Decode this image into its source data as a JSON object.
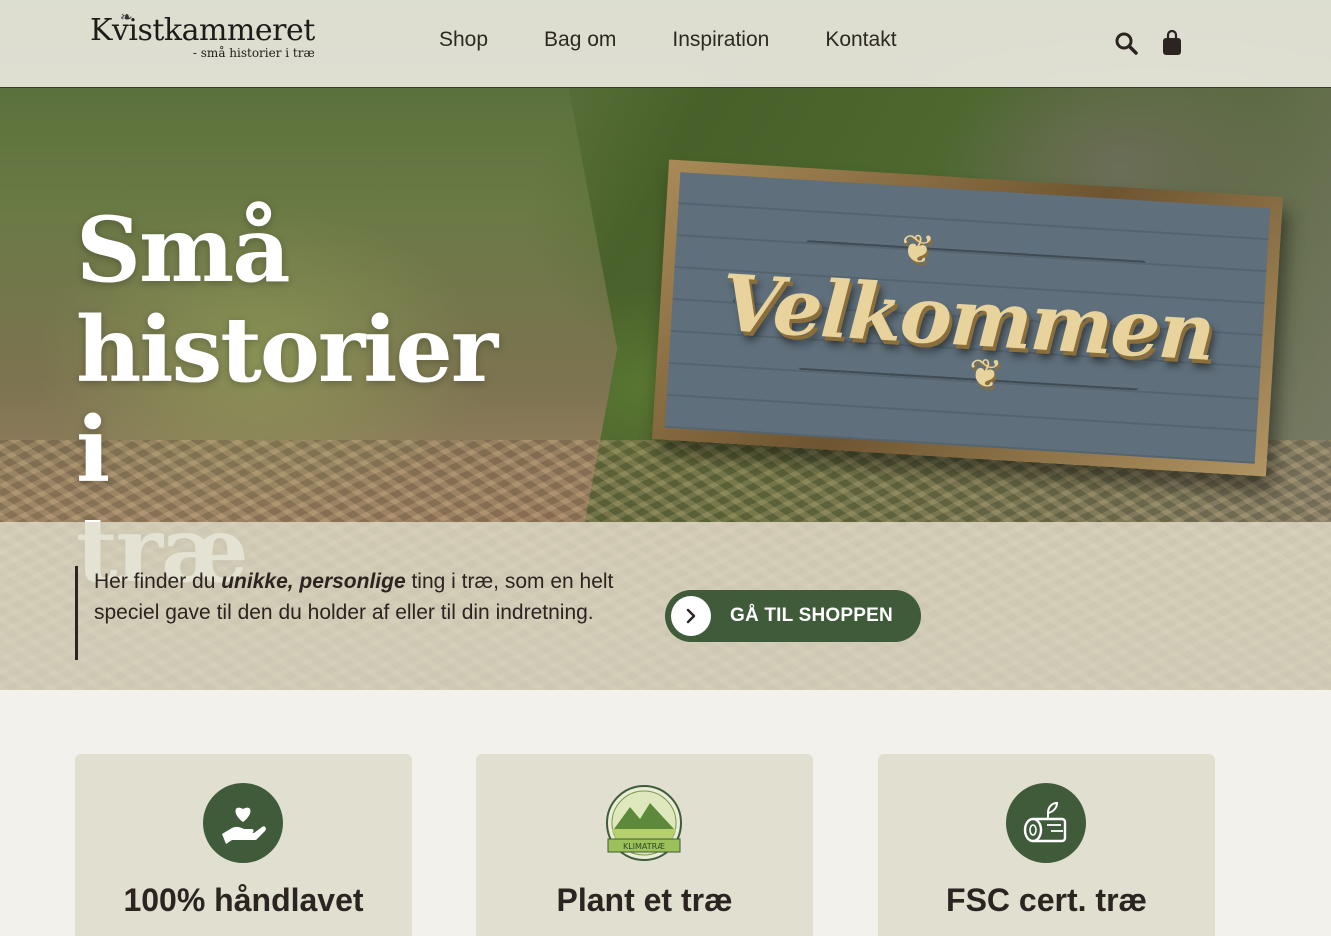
{
  "brand": {
    "name": "Kvistkammeret",
    "tagline": "- små historier i træ"
  },
  "nav": {
    "items": [
      {
        "label": "Shop"
      },
      {
        "label": "Bag om"
      },
      {
        "label": "Inspiration"
      },
      {
        "label": "Kontakt"
      }
    ]
  },
  "header_icons": [
    "search-icon",
    "shopping-bag-icon"
  ],
  "hero": {
    "title_lines": [
      "Små",
      "historier i",
      "træ"
    ],
    "sign_text": "Velkommen"
  },
  "intro": {
    "text_before": "Her finder du ",
    "emphasis": "unikke, personlige",
    "text_after": " ting i træ, som en helt speciel gave til den du holder af eller til din indretning.",
    "button_label": "GÅ TIL SHOPPEN"
  },
  "features": [
    {
      "title": "100% håndlavet",
      "icon": "heart-hand-icon"
    },
    {
      "title": "Plant et træ",
      "icon": "klimatrae-badge-icon",
      "badge_text": "KLIMATRÆ"
    },
    {
      "title": "FSC cert. træ",
      "icon": "log-icon"
    }
  ],
  "colors": {
    "accent_green": "#3f5b3a",
    "card_bg": "#e1dfd0",
    "page_bg": "#f3f1eb",
    "text": "#2b2420"
  }
}
